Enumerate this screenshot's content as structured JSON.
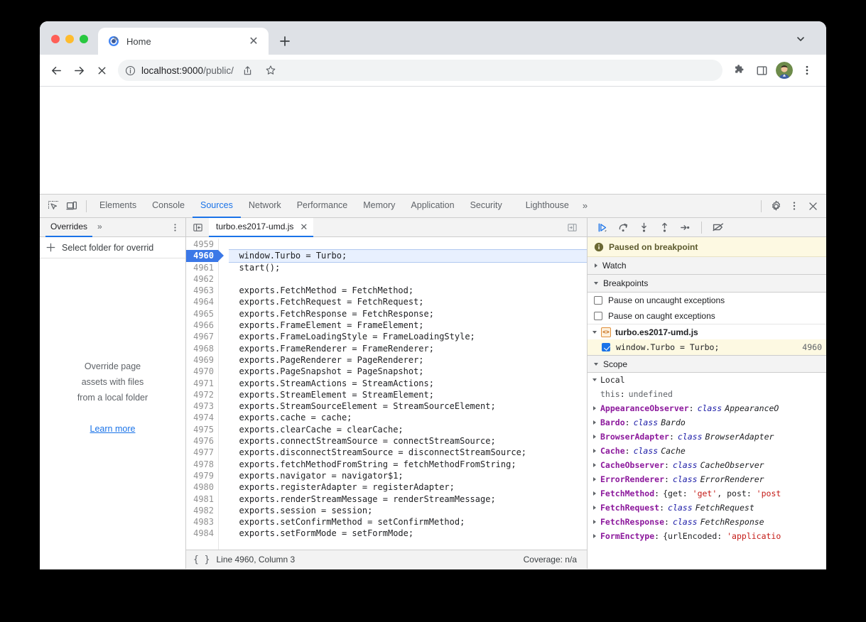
{
  "browser": {
    "tab": {
      "title": "Home",
      "favicon": "globe-favicon",
      "close_label": "✕"
    },
    "new_tab_label": "+",
    "tabstrip_chevron": "chevron-down-icon",
    "toolbar": {
      "back": "←",
      "forward": "→",
      "stop": "✕",
      "site_info_icon": "info-circle-icon",
      "url_host": "localhost:9000",
      "url_path": "/public/",
      "share_icon": "share-icon",
      "bookmark_icon": "star-icon",
      "extensions_icon": "puzzle-icon",
      "sidepanel_icon": "side-panel-icon",
      "avatar_icon": "profile-avatar",
      "menu_icon": "kebab-menu-icon"
    }
  },
  "devtools": {
    "inspect_icon": "inspect-element-icon",
    "device_icon": "device-toolbar-icon",
    "tabs": [
      {
        "label": "Elements",
        "selected": false
      },
      {
        "label": "Console",
        "selected": false
      },
      {
        "label": "Sources",
        "selected": true
      },
      {
        "label": "Network",
        "selected": false
      },
      {
        "label": "Performance",
        "selected": false
      },
      {
        "label": "Memory",
        "selected": false
      },
      {
        "label": "Application",
        "selected": false
      },
      {
        "label": "Security",
        "selected": false
      },
      {
        "label": "Lighthouse",
        "selected": false
      }
    ],
    "more_tabs": "»",
    "settings_icon": "gear-icon",
    "main_menu_icon": "kebab-menu-icon",
    "close_icon": "close-icon",
    "navigator": {
      "tab_label": "Overrides",
      "more": "»",
      "kebab": "kebab-menu-icon",
      "add_folder_label": "Select folder for overrid",
      "plus_icon": "plus-icon",
      "empty_line1": "Override page",
      "empty_line2": "assets with files",
      "empty_line3": "from a local folder",
      "learn_more": "Learn more"
    },
    "editor": {
      "navigator_toggle_icon": "show-navigator-icon",
      "sidebar_toggle_icon": "show-debugger-icon",
      "file_tab": "turbo.es2017-umd.js",
      "file_tab_close": "✕",
      "status": {
        "pretty_print_icon": "{ }",
        "cursor": "Line 4960, Column 3",
        "coverage": "Coverage: n/a"
      },
      "first_line": 4959,
      "active_line": 4960,
      "lines": [
        {
          "n": 4959,
          "text": ""
        },
        {
          "n": 4960,
          "text": "  window.Turbo = Turbo;"
        },
        {
          "n": 4961,
          "text": "  start();"
        },
        {
          "n": 4962,
          "text": ""
        },
        {
          "n": 4963,
          "text": "  exports.FetchMethod = FetchMethod;"
        },
        {
          "n": 4964,
          "text": "  exports.FetchRequest = FetchRequest;"
        },
        {
          "n": 4965,
          "text": "  exports.FetchResponse = FetchResponse;"
        },
        {
          "n": 4966,
          "text": "  exports.FrameElement = FrameElement;"
        },
        {
          "n": 4967,
          "text": "  exports.FrameLoadingStyle = FrameLoadingStyle;"
        },
        {
          "n": 4968,
          "text": "  exports.FrameRenderer = FrameRenderer;"
        },
        {
          "n": 4969,
          "text": "  exports.PageRenderer = PageRenderer;"
        },
        {
          "n": 4970,
          "text": "  exports.PageSnapshot = PageSnapshot;"
        },
        {
          "n": 4971,
          "text": "  exports.StreamActions = StreamActions;"
        },
        {
          "n": 4972,
          "text": "  exports.StreamElement = StreamElement;"
        },
        {
          "n": 4973,
          "text": "  exports.StreamSourceElement = StreamSourceElement;"
        },
        {
          "n": 4974,
          "text": "  exports.cache = cache;"
        },
        {
          "n": 4975,
          "text": "  exports.clearCache = clearCache;"
        },
        {
          "n": 4976,
          "text": "  exports.connectStreamSource = connectStreamSource;"
        },
        {
          "n": 4977,
          "text": "  exports.disconnectStreamSource = disconnectStreamSource;"
        },
        {
          "n": 4978,
          "text": "  exports.fetchMethodFromString = fetchMethodFromString;"
        },
        {
          "n": 4979,
          "text": "  exports.navigator = navigator$1;"
        },
        {
          "n": 4980,
          "text": "  exports.registerAdapter = registerAdapter;"
        },
        {
          "n": 4981,
          "text": "  exports.renderStreamMessage = renderStreamMessage;"
        },
        {
          "n": 4982,
          "text": "  exports.session = session;"
        },
        {
          "n": 4983,
          "text": "  exports.setConfirmMethod = setConfirmMethod;"
        },
        {
          "n": 4984,
          "text": "  exports.setFormMode = setFormMode;"
        }
      ]
    },
    "debugger": {
      "controls": [
        {
          "name": "resume-script-execution",
          "glyph": "resume"
        },
        {
          "name": "step-over-next-function-call",
          "glyph": "step-over"
        },
        {
          "name": "step-into-next-function-call",
          "glyph": "step-into"
        },
        {
          "name": "step-out-of-current-function",
          "glyph": "step-out"
        },
        {
          "name": "step",
          "glyph": "step"
        },
        {
          "name": "deactivate-breakpoints",
          "glyph": "deactivate"
        }
      ],
      "paused_banner": "Paused on breakpoint",
      "watch_label": "Watch",
      "breakpoints_label": "Breakpoints",
      "pause_uncaught_label": "Pause on uncaught exceptions",
      "pause_uncaught_checked": false,
      "pause_caught_label": "Pause on caught exceptions",
      "pause_caught_checked": false,
      "bp_file": "turbo.es2017-umd.js",
      "bp_entry_text": "window.Turbo = Turbo;",
      "bp_entry_line": "4960",
      "bp_entry_checked": true,
      "scope_label": "Scope",
      "scope_local_label": "Local",
      "scope_rows": [
        {
          "indent": 2,
          "arrow": "none",
          "name": "this",
          "name_style": "dim",
          "sep": ":",
          "value": "undefined",
          "value_style": "plain"
        },
        {
          "indent": 1,
          "arrow": "closed",
          "name": "AppearanceObserver",
          "sep": ":",
          "kw": "class",
          "value": "AppearanceO",
          "value_style": "class"
        },
        {
          "indent": 1,
          "arrow": "closed",
          "name": "Bardo",
          "sep": ":",
          "kw": "class",
          "value": "Bardo",
          "value_style": "class"
        },
        {
          "indent": 1,
          "arrow": "closed",
          "name": "BrowserAdapter",
          "sep": ":",
          "kw": "class",
          "value": "BrowserAdapter",
          "value_style": "class"
        },
        {
          "indent": 1,
          "arrow": "closed",
          "name": "Cache",
          "sep": ":",
          "kw": "class",
          "value": "Cache",
          "value_style": "class"
        },
        {
          "indent": 1,
          "arrow": "closed",
          "name": "CacheObserver",
          "sep": ":",
          "kw": "class",
          "value": "CacheObserver",
          "value_style": "class"
        },
        {
          "indent": 1,
          "arrow": "closed",
          "name": "ErrorRenderer",
          "sep": ":",
          "kw": "class",
          "value": "ErrorRenderer",
          "value_style": "class"
        },
        {
          "indent": 1,
          "arrow": "closed",
          "name": "FetchMethod",
          "sep": ":",
          "value": "{get: 'get', post: 'post",
          "value_style": "obj"
        },
        {
          "indent": 1,
          "arrow": "closed",
          "name": "FetchRequest",
          "sep": ":",
          "kw": "class",
          "value": "FetchRequest",
          "value_style": "class"
        },
        {
          "indent": 1,
          "arrow": "closed",
          "name": "FetchResponse",
          "sep": ":",
          "kw": "class",
          "value": "FetchResponse",
          "value_style": "class"
        },
        {
          "indent": 1,
          "arrow": "closed",
          "name": "FormEnctype",
          "sep": ":",
          "value": "{urlEncoded: 'applicatio",
          "value_style": "obj"
        }
      ]
    }
  }
}
